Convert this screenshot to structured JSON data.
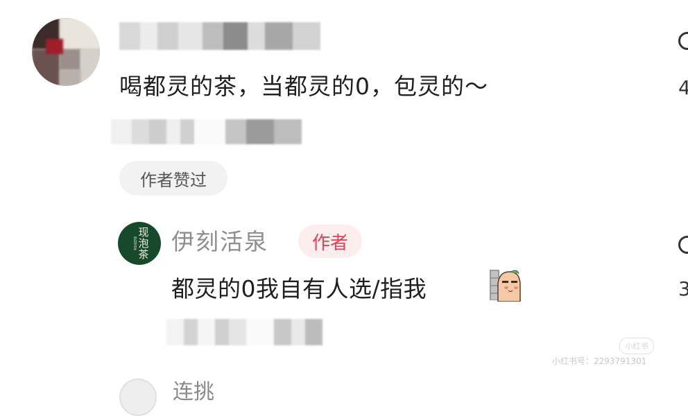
{
  "comment1": {
    "text": "喝都灵的茶，当都灵的0，包灵的～",
    "author_liked_badge": "作者赞过"
  },
  "reply": {
    "avatar_text": "现泡茶",
    "avatar_subtext": "伊刻活泉",
    "username": "伊刻活泉",
    "author_badge": "作者",
    "text": "都灵的0我自有人选/指我",
    "sticker": "peeking-sticker"
  },
  "right_side": {
    "count1": "4",
    "count2": "3"
  },
  "next_comment": {
    "name_partial": "连挑"
  },
  "watermark": {
    "logo": "小红书",
    "text": "小红书号：2293791301"
  },
  "colors": {
    "author_badge": "#e43f55",
    "author_badge_bg": "#fdeeee",
    "liked_badge_bg": "#f2f2f2",
    "avatar2_bg": "#174a2a"
  }
}
